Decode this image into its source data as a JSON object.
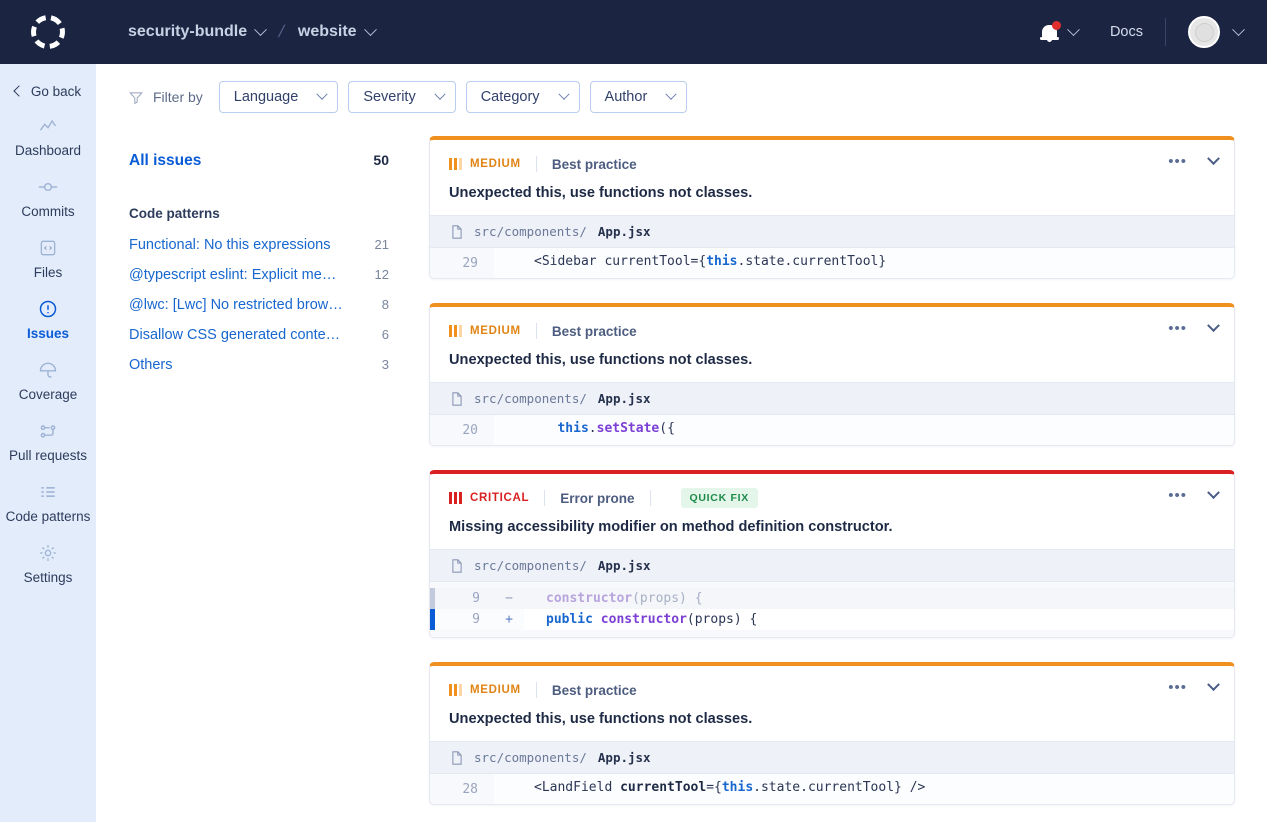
{
  "header": {
    "logo_icon": "codacy-ring-logo",
    "breadcrumb": [
      {
        "label": "security-bundle",
        "icon": "chevron-down-icon"
      },
      {
        "label": "website",
        "icon": "chevron-down-icon"
      }
    ],
    "separator": "/",
    "notifications": {
      "icon": "bell-icon",
      "has_unread": true,
      "chevron": "chevron-down-icon"
    },
    "docs_label": "Docs",
    "avatar": {
      "icon": "user-avatar",
      "chevron": "chevron-down-icon"
    },
    "bg_color": "#1b2441"
  },
  "sidebar": {
    "go_back_label": "Go back",
    "bg_color": "#e2ecfb",
    "items": [
      {
        "label": "Dashboard",
        "icon": "chart-line-icon",
        "active": false
      },
      {
        "label": "Commits",
        "icon": "commit-node-icon",
        "active": false
      },
      {
        "label": "Files",
        "icon": "code-file-icon",
        "active": false
      },
      {
        "label": "Issues",
        "icon": "alert-circle-icon",
        "active": true
      },
      {
        "label": "Coverage",
        "icon": "umbrella-icon",
        "active": false
      },
      {
        "label": "Pull requests",
        "icon": "pull-request-icon",
        "active": false
      },
      {
        "label": "Code patterns",
        "icon": "list-icon",
        "active": false
      },
      {
        "label": "Settings",
        "icon": "gear-icon",
        "active": false
      }
    ]
  },
  "filterbar": {
    "icon": "funnel-icon",
    "label": "Filter by",
    "filters": [
      {
        "label": "Language",
        "icon": "chevron-down-icon"
      },
      {
        "label": "Severity",
        "icon": "chevron-down-icon"
      },
      {
        "label": "Category",
        "icon": "chevron-down-icon"
      },
      {
        "label": "Author",
        "icon": "chevron-down-icon"
      }
    ]
  },
  "left_panel": {
    "all_issues": {
      "label": "All issues",
      "count": "50"
    },
    "section_title": "Code patterns",
    "patterns": [
      {
        "label": "Functional: No this expressions",
        "count": "21"
      },
      {
        "label": "@typescript eslint: Explicit mem…",
        "count": "12"
      },
      {
        "label": "@lwc: [Lwc] No restricted browse…",
        "count": "8"
      },
      {
        "label": "Disallow CSS generated content …",
        "count": "6"
      },
      {
        "label": "Others",
        "count": "3"
      }
    ]
  },
  "issues": [
    {
      "severity": "MEDIUM",
      "severity_color": "#e08416",
      "accent_color": "#f0901e",
      "category": "Best practice",
      "quick_fix": null,
      "title": "Unexpected this, use functions not classes.",
      "file_dir": "src/components/",
      "file_name": "App.jsx",
      "code": {
        "line": "29",
        "text": "<Sidebar currentTool={this.state.currentTool}"
      }
    },
    {
      "severity": "MEDIUM",
      "severity_color": "#e08416",
      "accent_color": "#f0901e",
      "category": "Best practice",
      "quick_fix": null,
      "title": "Unexpected this, use functions not classes.",
      "file_dir": "src/components/",
      "file_name": "App.jsx",
      "code": {
        "line": "20",
        "text": "this.setState({"
      }
    },
    {
      "severity": "CRITICAL",
      "severity_color": "#d92121",
      "accent_color": "#d92121",
      "category": "Error prone",
      "quick_fix": "QUICK FIX",
      "title": "Missing accessibility modifier on method definition constructor.",
      "file_dir": "src/components/",
      "file_name": "App.jsx",
      "diff": [
        {
          "line": "9",
          "sign": "−",
          "type": "removed",
          "text": "constructor(props) {"
        },
        {
          "line": "9",
          "sign": "+",
          "type": "added",
          "text": "public constructor(props) {"
        }
      ]
    },
    {
      "severity": "MEDIUM",
      "severity_color": "#e08416",
      "accent_color": "#f0901e",
      "category": "Best practice",
      "quick_fix": null,
      "title": "Unexpected this, use functions not classes.",
      "file_dir": "src/components/",
      "file_name": "App.jsx",
      "code": {
        "line": "28",
        "text": "<LandField currentTool={this.state.currentTool} />"
      }
    }
  ],
  "card_actions": {
    "more_icon": "ellipsis-icon",
    "collapse_icon": "chevron-down-icon"
  }
}
